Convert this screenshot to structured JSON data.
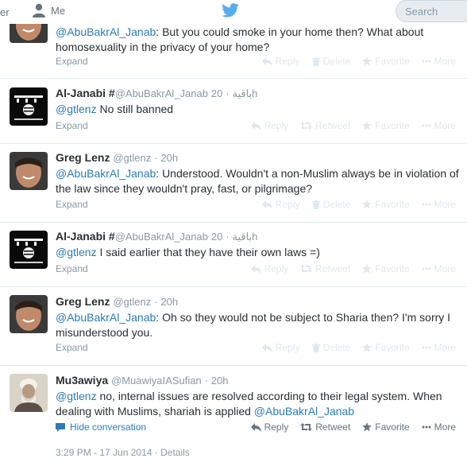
{
  "nav": {
    "left_fragment": "er",
    "me_label": "Me",
    "search_placeholder": "Search"
  },
  "tweets": [
    {
      "fullname": "",
      "username": "",
      "arabic": "",
      "time": "",
      "text_parts": [
        "@AbuBakrAl_Janab",
        ": But you could smoke in your home then? What about homosexuality in the privacy of your home?"
      ],
      "footer_left": "Expand",
      "actions": [
        "Reply",
        "Delete",
        "Favorite",
        "More"
      ]
    },
    {
      "fullname": "Al-Janabi #",
      "username": "@AbuBakrAl_Janab",
      "arabic": "باقية",
      "time": "20h",
      "mention": "@gtlenz",
      "text": " No still banned",
      "footer_left": "Expand",
      "actions": [
        "Reply",
        "Retweet",
        "Favorite",
        "More"
      ]
    },
    {
      "fullname": "Greg Lenz",
      "username": "@gtlenz",
      "time": "20h",
      "mention": "@AbuBakrAl_Janab",
      "text": ": Understood. Wouldn't a non-Muslim always be in violation of the law since they wouldn't pray, fast, or pilgrimage?",
      "footer_left": "Expand",
      "actions": [
        "Reply",
        "Delete",
        "Favorite",
        "More"
      ]
    },
    {
      "fullname": "Al-Janabi #",
      "username": "@AbuBakrAl_Janab",
      "arabic": "باقية",
      "time": "20h",
      "mention": "@gtlenz",
      "text": " I said earlier that they have their own laws =)",
      "footer_left": "Expand",
      "actions": [
        "Reply",
        "Retweet",
        "Favorite",
        "More"
      ]
    },
    {
      "fullname": "Greg Lenz",
      "username": "@gtlenz",
      "time": "20h",
      "mention": "@AbuBakrAl_Janab",
      "text": ": Oh so they would not be subject to Sharia then? I'm sorry I misunderstood you.",
      "footer_left": "Expand",
      "actions": [
        "Reply",
        "Delete",
        "Favorite",
        "More"
      ]
    },
    {
      "fullname": "Mu3awiya",
      "username": "@MuawiyaIASufian",
      "time": "20h",
      "mention": "@gtlenz",
      "text": " no, internal issues are resolved according to their legal system. When dealing with Muslims, shariah is applied ",
      "mention2": "@AbuBakrAl_Janab",
      "footer_left": "Hide conversation",
      "actions": [
        "Reply",
        "Retweet",
        "Favorite",
        "More"
      ],
      "meta_time": "3:29 PM - 17 Jun 2014",
      "meta_sep": "·",
      "meta_details": "Details"
    }
  ],
  "colors": {
    "link": "#2b7bb9",
    "muted": "#8899a6",
    "faded_action": "#e1e8ed",
    "active_action": "#66757f",
    "twitter_blue": "#55acee"
  }
}
